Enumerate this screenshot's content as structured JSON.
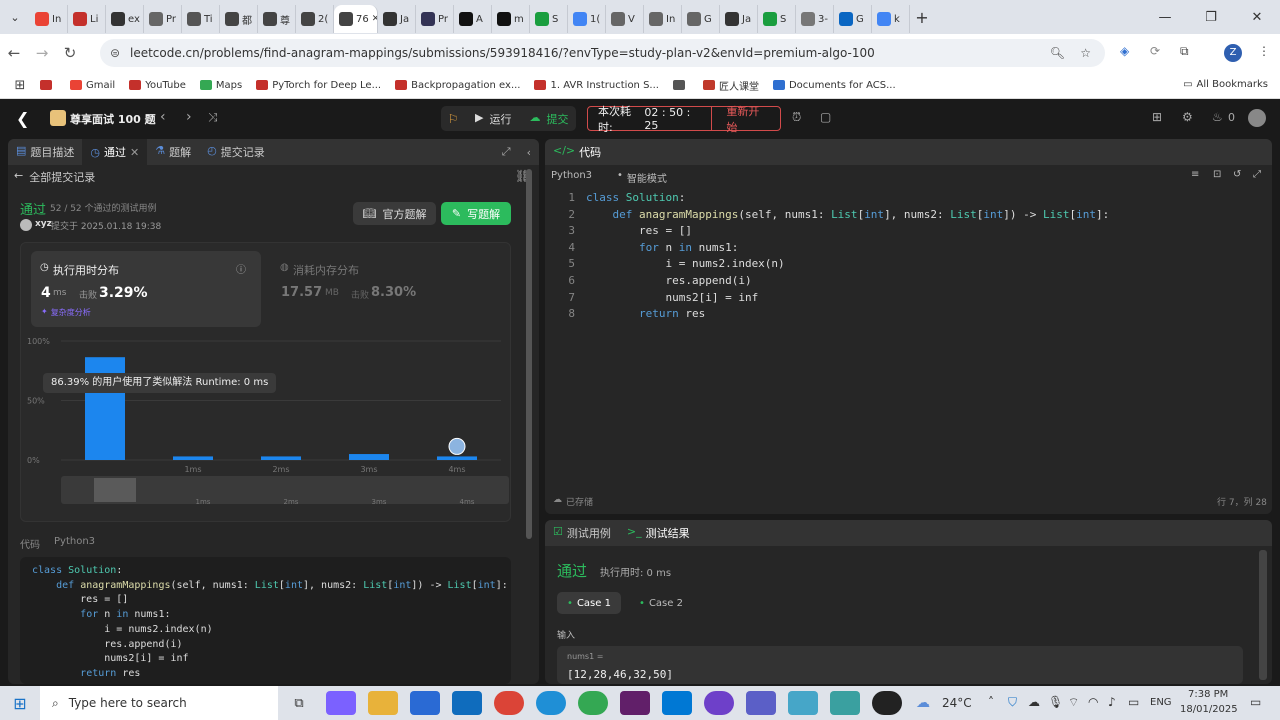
{
  "browser": {
    "tabs": [
      {
        "label": "In",
        "color": "#ea4335"
      },
      {
        "label": "Li",
        "color": "#c4302b"
      },
      {
        "label": "ex",
        "color": "#333"
      },
      {
        "label": "Pr",
        "color": "#666"
      },
      {
        "label": "Ti",
        "color": "#555"
      },
      {
        "label": "都",
        "color": "#444"
      },
      {
        "label": "尊",
        "color": "#444"
      },
      {
        "label": "2(",
        "color": "#444"
      },
      {
        "label": "76",
        "color": "#444",
        "active": true
      },
      {
        "label": "Ja",
        "color": "#333"
      },
      {
        "label": "Pr",
        "color": "#335"
      },
      {
        "label": "A",
        "color": "#111"
      },
      {
        "label": "m",
        "color": "#111"
      },
      {
        "label": "S",
        "color": "#1a9e3f"
      },
      {
        "label": "1(",
        "color": "#4285f4"
      },
      {
        "label": "V",
        "color": "#666"
      },
      {
        "label": "In",
        "color": "#666"
      },
      {
        "label": "G",
        "color": "#666"
      },
      {
        "label": "Ja",
        "color": "#333"
      },
      {
        "label": "S",
        "color": "#1a9e3f"
      },
      {
        "label": "3-",
        "color": "#777"
      },
      {
        "label": "G",
        "color": "#0a66c2"
      },
      {
        "label": "k",
        "color": "#4285f4"
      }
    ],
    "url": "leetcode.cn/problems/find-anagram-mappings/submissions/593918416/?envType=study-plan-v2&envId=premium-algo-100",
    "bookmarks": [
      {
        "label": "",
        "color": "#c4302b"
      },
      {
        "label": "Gmail",
        "color": "#ea4335"
      },
      {
        "label": "YouTube",
        "color": "#c4302b"
      },
      {
        "label": "Maps",
        "color": "#34a853"
      },
      {
        "label": "PyTorch for Deep Le...",
        "color": "#c4302b"
      },
      {
        "label": "Backpropagation ex...",
        "color": "#c4302b"
      },
      {
        "label": "1. AVR Instruction S...",
        "color": "#c4302b"
      },
      {
        "label": "",
        "color": "#555"
      },
      {
        "label": "匠人课堂",
        "color": "#c0392b"
      },
      {
        "label": "Documents for ACS...",
        "color": "#2f6fd0"
      }
    ],
    "all_bookmarks": "All Bookmarks"
  },
  "lc": {
    "study_plan": "尊享面试 100 题",
    "run": "运行",
    "submit": "提交",
    "timer_label": "本次耗时:",
    "timer": "02 : 50 : 25",
    "restart": "重新开始",
    "fire_count": "0"
  },
  "left": {
    "tabs": [
      "题目描述",
      "通过",
      "题解",
      "提交记录"
    ],
    "back": "全部提交记录",
    "status": "通过",
    "passed": "52 / 52 个通过的测试用例",
    "user": "xyz",
    "submitted_at": "提交于 2025.01.18 19:38",
    "official_btn": "官方题解",
    "write_btn": "写题解",
    "runtime_title": "执行用时分布",
    "runtime_value": "4",
    "runtime_unit": "ms",
    "beats_label": "击败",
    "runtime_beats": "3.29%",
    "analyze": "复杂度分析",
    "memory_title": "消耗内存分布",
    "memory_value": "17.57",
    "memory_unit": "MB",
    "memory_beats": "8.30%",
    "tooltip": "86.39% 的用户使用了类似解法 Runtime: 0 ms",
    "code_label": "代码",
    "code_lang": "Python3"
  },
  "chart_data": {
    "type": "bar",
    "categories": [
      "0ms",
      "1ms",
      "2ms",
      "3ms",
      "4ms"
    ],
    "tick_labels": [
      "",
      "1ms",
      "2ms",
      "3ms",
      "4ms"
    ],
    "values": [
      86.39,
      3,
      3,
      5,
      3
    ],
    "ylabels": [
      "100%",
      "50%",
      "0%"
    ],
    "ylim": [
      0,
      100
    ]
  },
  "editor": {
    "title": "代码",
    "lang": "Python3",
    "mode": "智能模式",
    "saved": "已存储",
    "cursor": "行 7，列 28",
    "lines": [
      "<span class='kw'>class</span> <span class='cls'>Solution</span>:",
      "    <span class='kw'>def</span> <span class='fn'>anagramMappings</span>(self, nums1: <span class='ty'>List</span>[<span class='kw'>int</span>], nums2: <span class='ty'>List</span>[<span class='kw'>int</span>]) -> <span class='ty'>List</span>[<span class='kw'>int</span>]:",
      "        res = []",
      "        <span class='kw'>for</span> n <span class='kw'>in</span> nums1:",
      "            i = nums2.index(n)",
      "            res.append(i)",
      "            nums2[i] = inf",
      "        <span class='kw'>return</span> res"
    ]
  },
  "console": {
    "tab_cases": "测试用例",
    "tab_result": "测试结果",
    "status": "通过",
    "runtime": "执行用时: 0 ms",
    "cases": [
      "Case 1",
      "Case 2"
    ],
    "input_label": "输入",
    "var": "nums1 =",
    "value": "[12,28,46,32,50]"
  },
  "taskbar": {
    "search": "Type here to search",
    "temp": "24°C",
    "lang": "ENG",
    "time": "7:38 PM",
    "date": "18/01/2025"
  }
}
